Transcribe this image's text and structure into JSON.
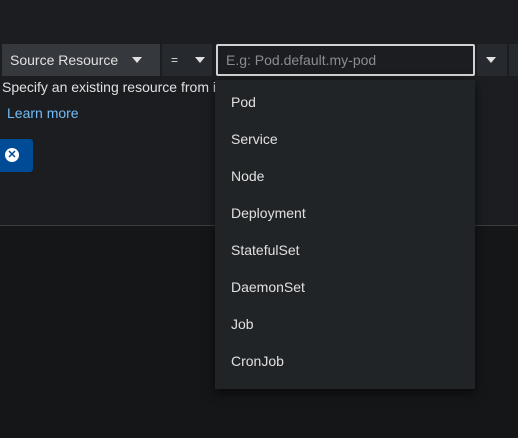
{
  "filter": {
    "field_label": "Source Resource",
    "operator_label": "=",
    "value_placeholder": "E.g: Pod.default.my-pod",
    "value": ""
  },
  "helper_text": "Specify an existing resource from i",
  "learn_more_label": "Learn more",
  "remove_icon_glyph": "✕",
  "menu": {
    "items": [
      "Pod",
      "Service",
      "Node",
      "Deployment",
      "StatefulSet",
      "DaemonSet",
      "Job",
      "CronJob"
    ]
  },
  "colors": {
    "background": "#1b1d21",
    "link": "#73bcf7",
    "remove_button": "#004b95"
  }
}
